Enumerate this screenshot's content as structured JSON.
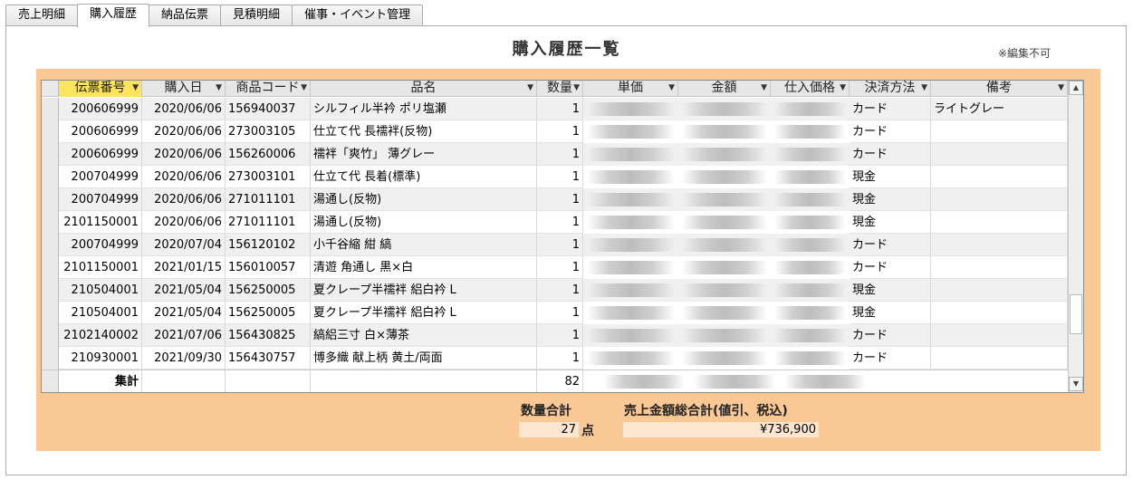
{
  "tabs": [
    "売上明細",
    "購入履歴",
    "納品伝票",
    "見積明細",
    "催事・イベント管理"
  ],
  "active_tab": 1,
  "title": "購入履歴一覧",
  "note": "※編集不可",
  "columns": [
    "伝票番号",
    "購入日",
    "商品コード",
    "品名",
    "数量",
    "単価",
    "金額",
    "仕入価格",
    "決済方法",
    "備考"
  ],
  "rows": [
    {
      "slip": "200606999",
      "date": "2020/06/06",
      "code": "156940037",
      "name": "シルフィル半衿 ポリ塩瀬",
      "qty": "1",
      "pay": "カード",
      "memo": "ライトグレー"
    },
    {
      "slip": "200606999",
      "date": "2020/06/06",
      "code": "273003105",
      "name": "仕立て代 長襦袢(反物)",
      "qty": "1",
      "pay": "カード",
      "memo": ""
    },
    {
      "slip": "200606999",
      "date": "2020/06/06",
      "code": "156260006",
      "name": "襦袢「爽竹」 薄グレー",
      "qty": "1",
      "pay": "カード",
      "memo": ""
    },
    {
      "slip": "200704999",
      "date": "2020/06/06",
      "code": "273003101",
      "name": "仕立て代 長着(標準)",
      "qty": "1",
      "pay": "現金",
      "memo": ""
    },
    {
      "slip": "200704999",
      "date": "2020/06/06",
      "code": "271011101",
      "name": "湯通し(反物)",
      "qty": "1",
      "pay": "現金",
      "memo": ""
    },
    {
      "slip": "2101150001",
      "date": "2020/06/06",
      "code": "271011101",
      "name": "湯通し(反物)",
      "qty": "1",
      "pay": "現金",
      "memo": ""
    },
    {
      "slip": "200704999",
      "date": "2020/07/04",
      "code": "156120102",
      "name": "小千谷縮 紺 縞",
      "qty": "1",
      "pay": "カード",
      "memo": ""
    },
    {
      "slip": "2101150001",
      "date": "2021/01/15",
      "code": "156010057",
      "name": "清遊 角通し 黒×白",
      "qty": "1",
      "pay": "カード",
      "memo": ""
    },
    {
      "slip": "210504001",
      "date": "2021/05/04",
      "code": "156250005",
      "name": "夏クレープ半襦袢 絽白衿 L",
      "qty": "1",
      "pay": "現金",
      "memo": ""
    },
    {
      "slip": "210504001",
      "date": "2021/05/04",
      "code": "156250005",
      "name": "夏クレープ半襦袢 絽白衿 L",
      "qty": "1",
      "pay": "現金",
      "memo": ""
    },
    {
      "slip": "2102140002",
      "date": "2021/07/06",
      "code": "156430825",
      "name": "縞絽三寸 白×薄茶",
      "qty": "1",
      "pay": "カード",
      "memo": ""
    },
    {
      "slip": "210930001",
      "date": "2021/09/30",
      "code": "156430757",
      "name": "博多織 献上柄 黄土/両面",
      "qty": "1",
      "pay": "カード",
      "memo": ""
    }
  ],
  "total": {
    "label": "集計",
    "qty": "82"
  },
  "summary": {
    "qty_label": "数量合計",
    "qty_value": "27",
    "qty_unit": "点",
    "amount_label": "売上金額総合計(値引、税込)",
    "amount_value": "¥736,900"
  },
  "colors": {
    "accent": "#fac895",
    "selected_header": "#fce45c"
  }
}
